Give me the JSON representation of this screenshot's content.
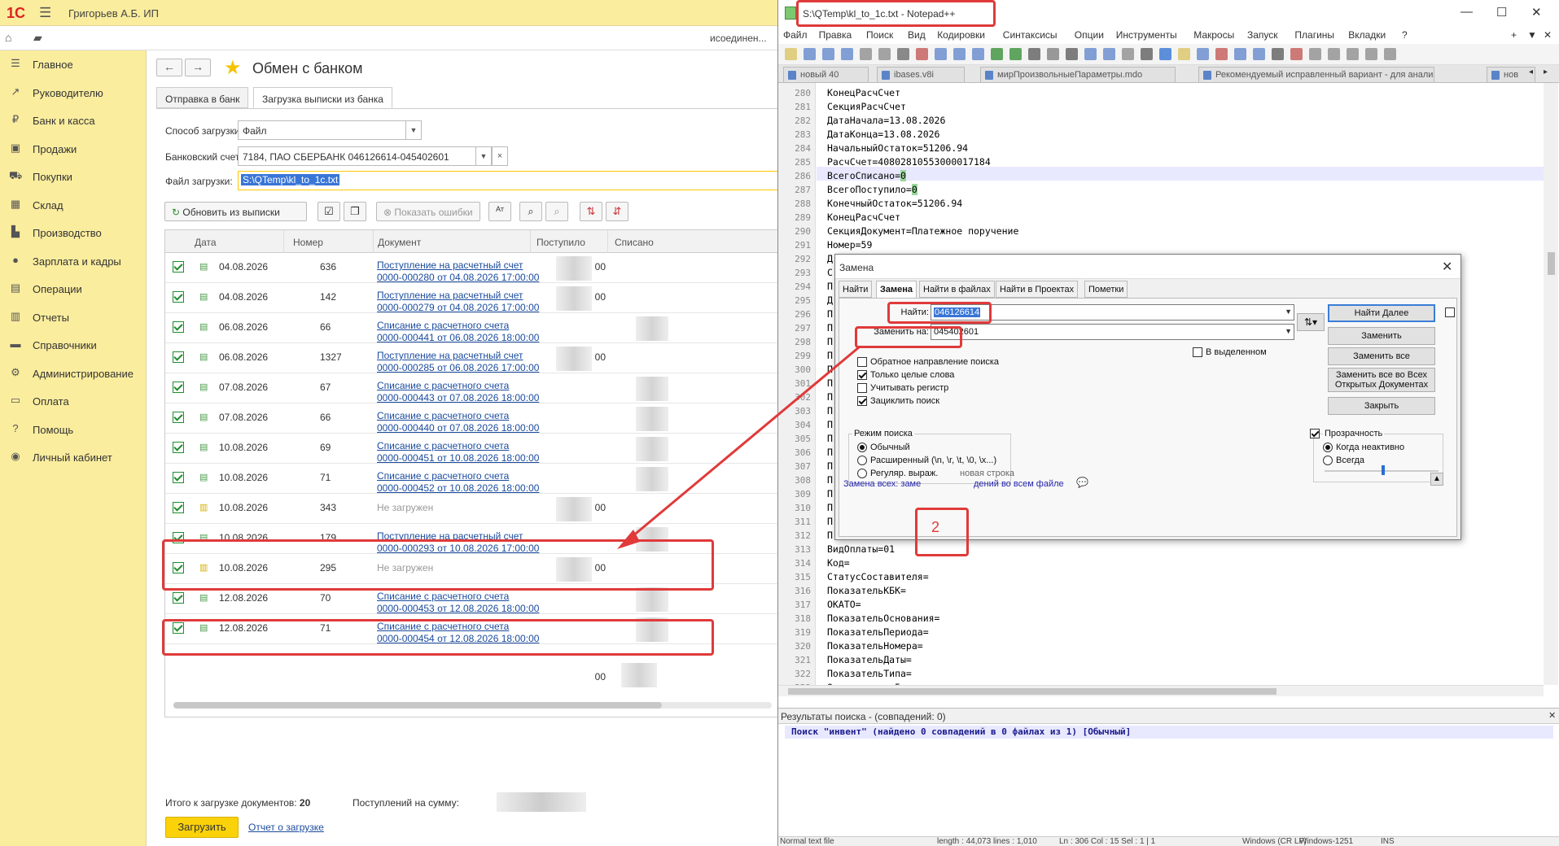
{
  "app1c": {
    "logo": "1С",
    "user": "Григорьев А.Б. ИП",
    "connection": "исоединен...",
    "sidebar": [
      {
        "label": "Главное",
        "icon": "menu-icon"
      },
      {
        "label": "Руководителю",
        "icon": "chart-icon"
      },
      {
        "label": "Банк и касса",
        "icon": "bank-icon"
      },
      {
        "label": "Продажи",
        "icon": "bag-icon"
      },
      {
        "label": "Покупки",
        "icon": "cart-icon"
      },
      {
        "label": "Склад",
        "icon": "warehouse-icon"
      },
      {
        "label": "Производство",
        "icon": "factory-icon"
      },
      {
        "label": "Зарплата и кадры",
        "icon": "person-icon"
      },
      {
        "label": "Операции",
        "icon": "operations-icon"
      },
      {
        "label": "Отчеты",
        "icon": "reports-icon"
      },
      {
        "label": "Справочники",
        "icon": "book-icon"
      },
      {
        "label": "Администрирование",
        "icon": "gear-icon"
      },
      {
        "label": "Оплата",
        "icon": "payment-icon"
      },
      {
        "label": "Помощь",
        "icon": "question-icon"
      },
      {
        "label": "Личный кабинет",
        "icon": "account-icon"
      }
    ],
    "title": "Обмен с банком",
    "tabs": [
      "Отправка в банк",
      "Загрузка выписки из банка"
    ],
    "form": {
      "method_label": "Способ загрузки:",
      "method_value": "Файл",
      "account_label": "Банковский счет:",
      "account_value": "7184, ПАО СБЕРБАНК 046126614-045402601",
      "file_label": "Файл загрузки:",
      "file_value": "S:\\QTemp\\kl_to_1c.txt"
    },
    "toolbar": {
      "refresh": "Обновить из выписки",
      "show_errors": "Показать ошибки"
    },
    "grid": {
      "headers": [
        "Дата",
        "Номер",
        "Документ",
        "Поступило",
        "Списано"
      ],
      "rows": [
        {
          "date": "04.08.2026",
          "num": "636",
          "doc1": "Поступление на расчетный счет",
          "doc2": "0000-000280 от 04.08.2026 17:00:00",
          "in": "00",
          "loaded": true
        },
        {
          "date": "04.08.2026",
          "num": "142",
          "doc1": "Поступление на расчетный счет",
          "doc2": "0000-000279 от 04.08.2026 17:00:00",
          "in": "00",
          "loaded": true
        },
        {
          "date": "06.08.2026",
          "num": "66",
          "doc1": "Списание с расчетного счета",
          "doc2": "0000-000441 от 06.08.2026 18:00:00",
          "in": "",
          "loaded": true
        },
        {
          "date": "06.08.2026",
          "num": "1327",
          "doc1": "Поступление на расчетный счет",
          "doc2": "0000-000285 от 06.08.2026 17:00:00",
          "in": "00",
          "loaded": true
        },
        {
          "date": "07.08.2026",
          "num": "67",
          "doc1": "Списание с расчетного счета",
          "doc2": "0000-000443 от 07.08.2026 18:00:00",
          "in": "",
          "loaded": true
        },
        {
          "date": "07.08.2026",
          "num": "66",
          "doc1": "Списание с расчетного счета",
          "doc2": "0000-000440 от 07.08.2026 18:00:00",
          "in": "",
          "loaded": true
        },
        {
          "date": "10.08.2026",
          "num": "69",
          "doc1": "Списание с расчетного счета",
          "doc2": "0000-000451 от 10.08.2026 18:00:00",
          "in": "",
          "loaded": true
        },
        {
          "date": "10.08.2026",
          "num": "71",
          "doc1": "Списание с расчетного счета",
          "doc2": "0000-000452 от 10.08.2026 18:00:00",
          "in": "",
          "loaded": true
        },
        {
          "date": "10.08.2026",
          "num": "343",
          "doc1": "Не загружен",
          "doc2": "",
          "in": "00",
          "loaded": false
        },
        {
          "date": "10.08.2026",
          "num": "179",
          "doc1": "Поступление на расчетный счет",
          "doc2": "0000-000293 от 10.08.2026 17:00:00",
          "in": "",
          "loaded": true
        },
        {
          "date": "10.08.2026",
          "num": "295",
          "doc1": "Не загружен",
          "doc2": "",
          "in": "00",
          "loaded": false
        },
        {
          "date": "12.08.2026",
          "num": "70",
          "doc1": "Списание с расчетного счета",
          "doc2": "0000-000453 от 12.08.2026 18:00:00",
          "in": "",
          "loaded": true
        },
        {
          "date": "12.08.2026",
          "num": "71",
          "doc1": "Списание с расчетного счета",
          "doc2": "0000-000454 от 12.08.2026 18:00:00",
          "in": "",
          "loaded": true
        }
      ],
      "total_row_in": "00"
    },
    "footer": {
      "count_label": "Итого к загрузке документов:",
      "count_value": "20",
      "sum_label": "Поступлений на сумму:",
      "load_button": "Загрузить",
      "report_link": "Отчет о загрузке"
    }
  },
  "npp": {
    "title": "S:\\QTemp\\kl_to_1c.txt - Notepad++",
    "menu": [
      "Файл",
      "Правка",
      "Поиск",
      "Вид",
      "Кодировки",
      "Синтаксисы",
      "Опции",
      "Инструменты",
      "Макросы",
      "Запуск",
      "Плагины",
      "Вкладки",
      "?"
    ],
    "tabs": [
      "новый 40",
      "ibases.v8i",
      "мирПроизвольныеПараметры.mdo",
      "Рекомендуемый исправленный вариант - для анализа.txt",
      "нов"
    ],
    "lines": [
      {
        "n": "280",
        "t": "КонецРасчСчет"
      },
      {
        "n": "281",
        "t": "СекцияРасчСчет"
      },
      {
        "n": "282",
        "t": "ДатаНачала=13.08.2026"
      },
      {
        "n": "283",
        "t": "ДатаКонца=13.08.2026"
      },
      {
        "n": "284",
        "t": "НачальныйОстаток=51206.94"
      },
      {
        "n": "285",
        "t": "РасчСчет=40802810553000017184"
      },
      {
        "n": "286",
        "t": "ВсегоСписано=",
        "z": "0"
      },
      {
        "n": "287",
        "t": "ВсегоПоступило=",
        "z": "0"
      },
      {
        "n": "288",
        "t": "КонечныйОстаток=51206.94"
      },
      {
        "n": "289",
        "t": "КонецРасчСчет"
      },
      {
        "n": "290",
        "t": "СекцияДокумент=Платежное поручение"
      },
      {
        "n": "291",
        "t": "Номер=59"
      },
      {
        "n": "292",
        "t": "Д"
      },
      {
        "n": "293",
        "t": "С"
      },
      {
        "n": "294",
        "t": "П"
      },
      {
        "n": "295",
        "t": "Д"
      },
      {
        "n": "296",
        "t": "П"
      },
      {
        "n": "297",
        "t": "П"
      },
      {
        "n": "298",
        "t": "П"
      },
      {
        "n": "299",
        "t": "П"
      },
      {
        "n": "300",
        "t": "П"
      },
      {
        "n": "301",
        "t": "П"
      },
      {
        "n": "302",
        "t": "П"
      },
      {
        "n": "303",
        "t": "П"
      },
      {
        "n": "304",
        "t": "П"
      },
      {
        "n": "305",
        "t": "П"
      },
      {
        "n": "306",
        "t": "П"
      },
      {
        "n": "307",
        "t": "П"
      },
      {
        "n": "308",
        "t": "П"
      },
      {
        "n": "309",
        "t": "П"
      },
      {
        "n": "310",
        "t": "П"
      },
      {
        "n": "311",
        "t": "П"
      },
      {
        "n": "312",
        "t": "П"
      },
      {
        "n": "313",
        "t": "ВидОплаты=01"
      },
      {
        "n": "314",
        "t": "Код="
      },
      {
        "n": "315",
        "t": "СтатусСоставителя="
      },
      {
        "n": "316",
        "t": "ПоказательКБК="
      },
      {
        "n": "317",
        "t": "ОКАТО="
      },
      {
        "n": "318",
        "t": "ПоказательОснования="
      },
      {
        "n": "319",
        "t": "ПоказательПериода="
      },
      {
        "n": "320",
        "t": "ПоказательНомера="
      },
      {
        "n": "321",
        "t": "ПоказательДаты="
      },
      {
        "n": "322",
        "t": "ПоказательТипа="
      },
      {
        "n": "323",
        "t": "Очередность=5"
      }
    ],
    "results_title": "Результаты поиска - (совпадений: 0)",
    "results_line": "Поиск \"инвент\" (найдено 0 совпадений в 0 файлах из 1) [Обычный]",
    "status": [
      "Normal text file",
      "length : 44,073    lines : 1,010",
      "Ln : 306    Col : 15    Sel : 1 | 1",
      "Windows (CR LF)",
      "Windows-1251",
      "INS"
    ]
  },
  "dialog": {
    "title": "Замена",
    "tabs": [
      "Найти",
      "Замена",
      "Найти в файлах",
      "Найти в Проектах",
      "Пометки"
    ],
    "find_label": "Найти:",
    "find_value": "046126614",
    "replace_label": "Заменить на:",
    "replace_value": "045402601",
    "in_selection": "В выделенном",
    "options": [
      {
        "label": "Обратное направление поиска",
        "checked": false
      },
      {
        "label": "Только целые слова",
        "checked": true
      },
      {
        "label": "Учитывать регистр",
        "checked": false
      },
      {
        "label": "Зациклить поиск",
        "checked": true
      }
    ],
    "mode_title": "Режим поиска",
    "modes": [
      {
        "label": "Обычный",
        "checked": true
      },
      {
        "label": "Расширенный (\\n, \\r, \\t, \\0, \\x...)",
        "checked": false
      },
      {
        "label": "Регуляр. выраж.",
        "checked": false
      }
    ],
    "new_line": "новая строка",
    "transparency_title": "Прозрачность",
    "transparency_modes": [
      {
        "label": "Когда неактивно",
        "checked": true
      },
      {
        "label": "Всегда",
        "checked": false
      }
    ],
    "buttons": {
      "find_next": "Найти Далее",
      "replace": "Заменить",
      "replace_all": "Заменить все",
      "replace_all_open_1": "Заменить все во Всех",
      "replace_all_open_2": "Открытых Документах",
      "close": "Закрыть"
    },
    "status_left": "Замена всех: заме",
    "status_right": "дений во всем файле"
  },
  "annotation": {
    "step_number": "2",
    "color": "#e03a3a"
  }
}
